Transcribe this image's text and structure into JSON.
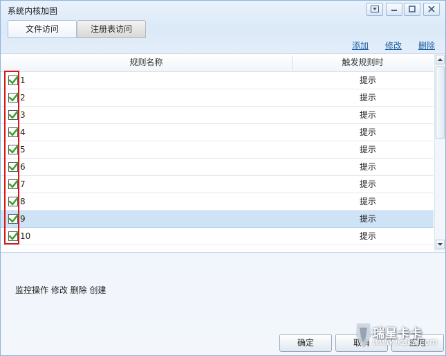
{
  "window": {
    "title": "系统内核加固",
    "controls": [
      "dropdown",
      "minimize",
      "maximize",
      "close"
    ]
  },
  "tabs": [
    {
      "label": "文件访问",
      "active": true
    },
    {
      "label": "注册表访问",
      "active": false
    }
  ],
  "actions": {
    "add": "添加",
    "edit": "修改",
    "delete": "删除"
  },
  "table": {
    "columns": [
      "规则名称",
      "触发规则时"
    ],
    "rows": [
      {
        "name": "1",
        "trigger": "提示",
        "checked": true,
        "selected": false
      },
      {
        "name": "2",
        "trigger": "提示",
        "checked": true,
        "selected": false
      },
      {
        "name": "3",
        "trigger": "提示",
        "checked": true,
        "selected": false
      },
      {
        "name": "4",
        "trigger": "提示",
        "checked": true,
        "selected": false
      },
      {
        "name": "5",
        "trigger": "提示",
        "checked": true,
        "selected": false
      },
      {
        "name": "6",
        "trigger": "提示",
        "checked": true,
        "selected": false
      },
      {
        "name": "7",
        "trigger": "提示",
        "checked": true,
        "selected": false
      },
      {
        "name": "8",
        "trigger": "提示",
        "checked": true,
        "selected": false
      },
      {
        "name": "9",
        "trigger": "提示",
        "checked": true,
        "selected": true
      },
      {
        "name": "10",
        "trigger": "提示",
        "checked": true,
        "selected": false
      }
    ]
  },
  "monitor_ops": "监控操作 修改 删除 创建",
  "buttons": {
    "ok": "确定",
    "cancel": "取消",
    "apply": "应用"
  },
  "watermark": {
    "title": "瑞星卡卡",
    "url": "www.ikaka.com"
  },
  "colors": {
    "accent_link": "#1f5fa6",
    "selected_row": "#cfe3f7",
    "highlight_box": "#d21a1a",
    "check": "#3aa12c"
  }
}
